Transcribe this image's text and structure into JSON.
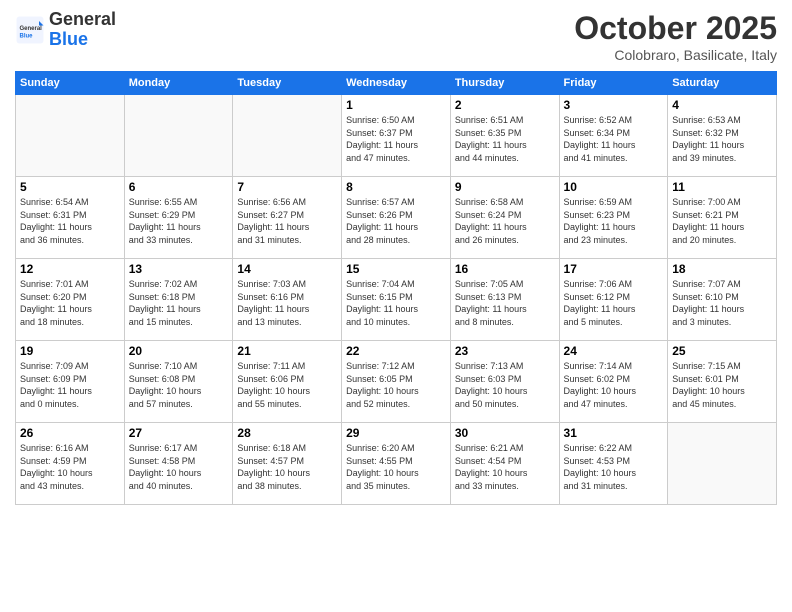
{
  "header": {
    "logo_general": "General",
    "logo_blue": "Blue",
    "month_title": "October 2025",
    "location": "Colobraro, Basilicate, Italy"
  },
  "weekdays": [
    "Sunday",
    "Monday",
    "Tuesday",
    "Wednesday",
    "Thursday",
    "Friday",
    "Saturday"
  ],
  "weeks": [
    [
      {
        "day": "",
        "info": ""
      },
      {
        "day": "",
        "info": ""
      },
      {
        "day": "",
        "info": ""
      },
      {
        "day": "1",
        "info": "Sunrise: 6:50 AM\nSunset: 6:37 PM\nDaylight: 11 hours\nand 47 minutes."
      },
      {
        "day": "2",
        "info": "Sunrise: 6:51 AM\nSunset: 6:35 PM\nDaylight: 11 hours\nand 44 minutes."
      },
      {
        "day": "3",
        "info": "Sunrise: 6:52 AM\nSunset: 6:34 PM\nDaylight: 11 hours\nand 41 minutes."
      },
      {
        "day": "4",
        "info": "Sunrise: 6:53 AM\nSunset: 6:32 PM\nDaylight: 11 hours\nand 39 minutes."
      }
    ],
    [
      {
        "day": "5",
        "info": "Sunrise: 6:54 AM\nSunset: 6:31 PM\nDaylight: 11 hours\nand 36 minutes."
      },
      {
        "day": "6",
        "info": "Sunrise: 6:55 AM\nSunset: 6:29 PM\nDaylight: 11 hours\nand 33 minutes."
      },
      {
        "day": "7",
        "info": "Sunrise: 6:56 AM\nSunset: 6:27 PM\nDaylight: 11 hours\nand 31 minutes."
      },
      {
        "day": "8",
        "info": "Sunrise: 6:57 AM\nSunset: 6:26 PM\nDaylight: 11 hours\nand 28 minutes."
      },
      {
        "day": "9",
        "info": "Sunrise: 6:58 AM\nSunset: 6:24 PM\nDaylight: 11 hours\nand 26 minutes."
      },
      {
        "day": "10",
        "info": "Sunrise: 6:59 AM\nSunset: 6:23 PM\nDaylight: 11 hours\nand 23 minutes."
      },
      {
        "day": "11",
        "info": "Sunrise: 7:00 AM\nSunset: 6:21 PM\nDaylight: 11 hours\nand 20 minutes."
      }
    ],
    [
      {
        "day": "12",
        "info": "Sunrise: 7:01 AM\nSunset: 6:20 PM\nDaylight: 11 hours\nand 18 minutes."
      },
      {
        "day": "13",
        "info": "Sunrise: 7:02 AM\nSunset: 6:18 PM\nDaylight: 11 hours\nand 15 minutes."
      },
      {
        "day": "14",
        "info": "Sunrise: 7:03 AM\nSunset: 6:16 PM\nDaylight: 11 hours\nand 13 minutes."
      },
      {
        "day": "15",
        "info": "Sunrise: 7:04 AM\nSunset: 6:15 PM\nDaylight: 11 hours\nand 10 minutes."
      },
      {
        "day": "16",
        "info": "Sunrise: 7:05 AM\nSunset: 6:13 PM\nDaylight: 11 hours\nand 8 minutes."
      },
      {
        "day": "17",
        "info": "Sunrise: 7:06 AM\nSunset: 6:12 PM\nDaylight: 11 hours\nand 5 minutes."
      },
      {
        "day": "18",
        "info": "Sunrise: 7:07 AM\nSunset: 6:10 PM\nDaylight: 11 hours\nand 3 minutes."
      }
    ],
    [
      {
        "day": "19",
        "info": "Sunrise: 7:09 AM\nSunset: 6:09 PM\nDaylight: 11 hours\nand 0 minutes."
      },
      {
        "day": "20",
        "info": "Sunrise: 7:10 AM\nSunset: 6:08 PM\nDaylight: 10 hours\nand 57 minutes."
      },
      {
        "day": "21",
        "info": "Sunrise: 7:11 AM\nSunset: 6:06 PM\nDaylight: 10 hours\nand 55 minutes."
      },
      {
        "day": "22",
        "info": "Sunrise: 7:12 AM\nSunset: 6:05 PM\nDaylight: 10 hours\nand 52 minutes."
      },
      {
        "day": "23",
        "info": "Sunrise: 7:13 AM\nSunset: 6:03 PM\nDaylight: 10 hours\nand 50 minutes."
      },
      {
        "day": "24",
        "info": "Sunrise: 7:14 AM\nSunset: 6:02 PM\nDaylight: 10 hours\nand 47 minutes."
      },
      {
        "day": "25",
        "info": "Sunrise: 7:15 AM\nSunset: 6:01 PM\nDaylight: 10 hours\nand 45 minutes."
      }
    ],
    [
      {
        "day": "26",
        "info": "Sunrise: 6:16 AM\nSunset: 4:59 PM\nDaylight: 10 hours\nand 43 minutes."
      },
      {
        "day": "27",
        "info": "Sunrise: 6:17 AM\nSunset: 4:58 PM\nDaylight: 10 hours\nand 40 minutes."
      },
      {
        "day": "28",
        "info": "Sunrise: 6:18 AM\nSunset: 4:57 PM\nDaylight: 10 hours\nand 38 minutes."
      },
      {
        "day": "29",
        "info": "Sunrise: 6:20 AM\nSunset: 4:55 PM\nDaylight: 10 hours\nand 35 minutes."
      },
      {
        "day": "30",
        "info": "Sunrise: 6:21 AM\nSunset: 4:54 PM\nDaylight: 10 hours\nand 33 minutes."
      },
      {
        "day": "31",
        "info": "Sunrise: 6:22 AM\nSunset: 4:53 PM\nDaylight: 10 hours\nand 31 minutes."
      },
      {
        "day": "",
        "info": ""
      }
    ]
  ]
}
